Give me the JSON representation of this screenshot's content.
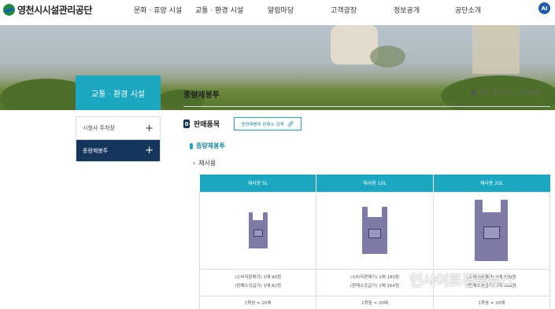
{
  "header": {
    "logo_text": "영천시시설관리공단",
    "nav": [
      "문화 · 휴양 시설",
      "교통 · 환경 시설",
      "알림마당",
      "고객광장",
      "정보공개",
      "공단소개"
    ],
    "ai_badge": "AI"
  },
  "sidebar": {
    "title": "교통 · 환경 시설",
    "items": [
      {
        "label": "시청사 주차장",
        "toggle": "+"
      },
      {
        "label": "종량제봉투",
        "toggle": "+"
      }
    ]
  },
  "content": {
    "page_title": "종량제봉투",
    "breadcrumb": [
      "교통 · 환경 시설",
      "종량제봉투"
    ],
    "section_number": "0",
    "section_title": "판매품목",
    "search_button": "종량제봉투 판매소 검색",
    "sub_title": "종량제봉투",
    "bullet": "재사용",
    "table": {
      "headers": [
        "재사용 5L",
        "재사용 10L",
        "재사용 20L"
      ],
      "consumer_prices": [
        "(소비자판매가) 1매 90원",
        "(소비자판매가) 1매 180원",
        "(소비자판매가) 1매 360원"
      ],
      "store_prices": [
        "(판매소공급가) 1매 82원",
        "(판매소공급가) 1매 164원",
        "(판매소공급가) 1매 328원"
      ],
      "bundle_units": [
        "1묶음 = 20매",
        "1묶음 = 20매",
        "1묶음 = 20매"
      ]
    }
  },
  "watermark": "인사이트경북뉴스",
  "colors": {
    "teal": "#1aa7bf",
    "navy": "#15365c",
    "bag": "#7d7aa8"
  }
}
